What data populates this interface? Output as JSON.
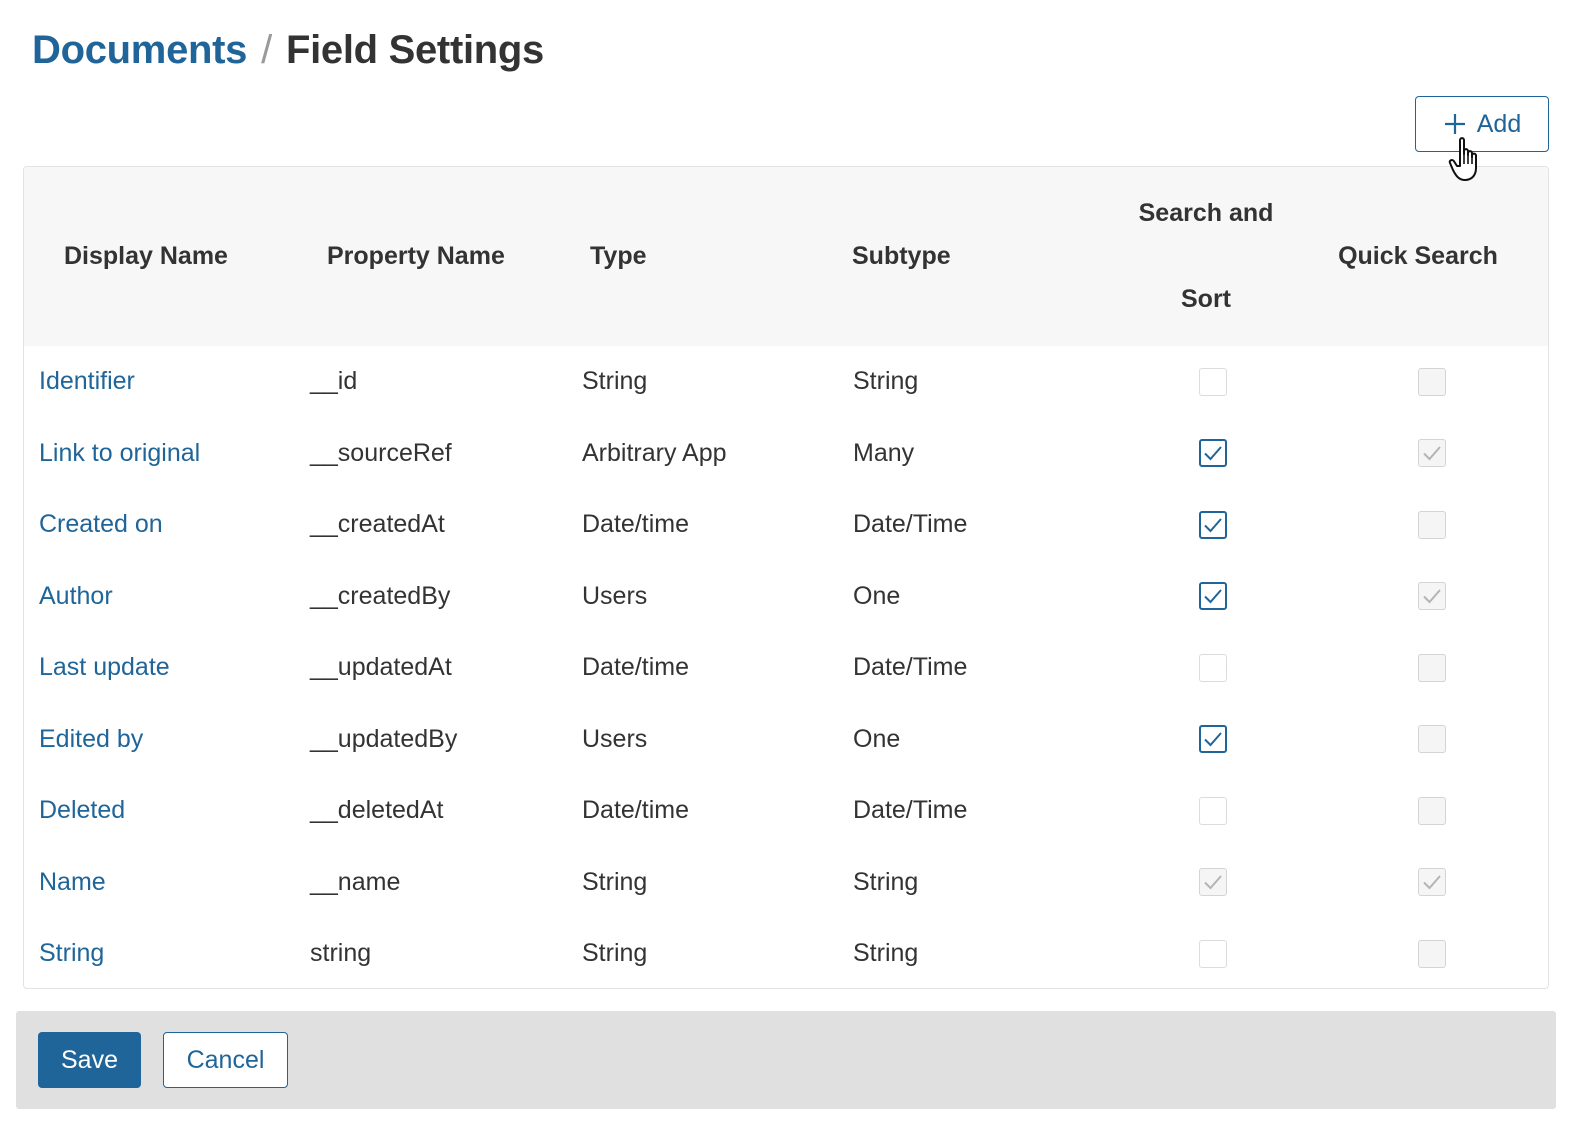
{
  "breadcrumb": {
    "parent": "Documents",
    "separator": "/",
    "current": "Field Settings"
  },
  "toolbar": {
    "add_label": "Add",
    "add_icon": "plus-icon"
  },
  "cursor": "hand-pointer-icon",
  "table": {
    "columns": [
      "Display Name",
      "Property Name",
      "Type",
      "Subtype",
      "Search and Sort",
      "Quick Search"
    ],
    "rows": [
      {
        "display_name": "Identifier",
        "property_name": "__id",
        "type": "String",
        "subtype": "String",
        "search_sort": {
          "checked": false,
          "disabled": false
        },
        "quick_search": {
          "checked": false,
          "disabled": true
        }
      },
      {
        "display_name": "Link to original",
        "property_name": "__sourceRef",
        "type": "Arbitrary App",
        "subtype": "Many",
        "search_sort": {
          "checked": true,
          "disabled": false
        },
        "quick_search": {
          "checked": true,
          "disabled": true
        }
      },
      {
        "display_name": "Created on",
        "property_name": "__createdAt",
        "type": "Date/time",
        "subtype": "Date/Time",
        "search_sort": {
          "checked": true,
          "disabled": false
        },
        "quick_search": {
          "checked": false,
          "disabled": true
        }
      },
      {
        "display_name": "Author",
        "property_name": "__createdBy",
        "type": "Users",
        "subtype": "One",
        "search_sort": {
          "checked": true,
          "disabled": false
        },
        "quick_search": {
          "checked": true,
          "disabled": true
        }
      },
      {
        "display_name": "Last update",
        "property_name": "__updatedAt",
        "type": "Date/time",
        "subtype": "Date/Time",
        "search_sort": {
          "checked": false,
          "disabled": false
        },
        "quick_search": {
          "checked": false,
          "disabled": true
        }
      },
      {
        "display_name": "Edited by",
        "property_name": "__updatedBy",
        "type": "Users",
        "subtype": "One",
        "search_sort": {
          "checked": true,
          "disabled": false
        },
        "quick_search": {
          "checked": false,
          "disabled": true
        }
      },
      {
        "display_name": "Deleted",
        "property_name": "__deletedAt",
        "type": "Date/time",
        "subtype": "Date/Time",
        "search_sort": {
          "checked": false,
          "disabled": false
        },
        "quick_search": {
          "checked": false,
          "disabled": true
        }
      },
      {
        "display_name": "Name",
        "property_name": "__name",
        "type": "String",
        "subtype": "String",
        "search_sort": {
          "checked": true,
          "disabled": true
        },
        "quick_search": {
          "checked": true,
          "disabled": true
        }
      },
      {
        "display_name": "String",
        "property_name": "string",
        "type": "String",
        "subtype": "String",
        "search_sort": {
          "checked": false,
          "disabled": false
        },
        "quick_search": {
          "checked": false,
          "disabled": true
        }
      }
    ]
  },
  "footer": {
    "save_label": "Save",
    "cancel_label": "Cancel"
  },
  "colors": {
    "accent": "#1f6599",
    "header_bg": "#f7f7f7",
    "footer_bg": "#e0e0e0"
  }
}
